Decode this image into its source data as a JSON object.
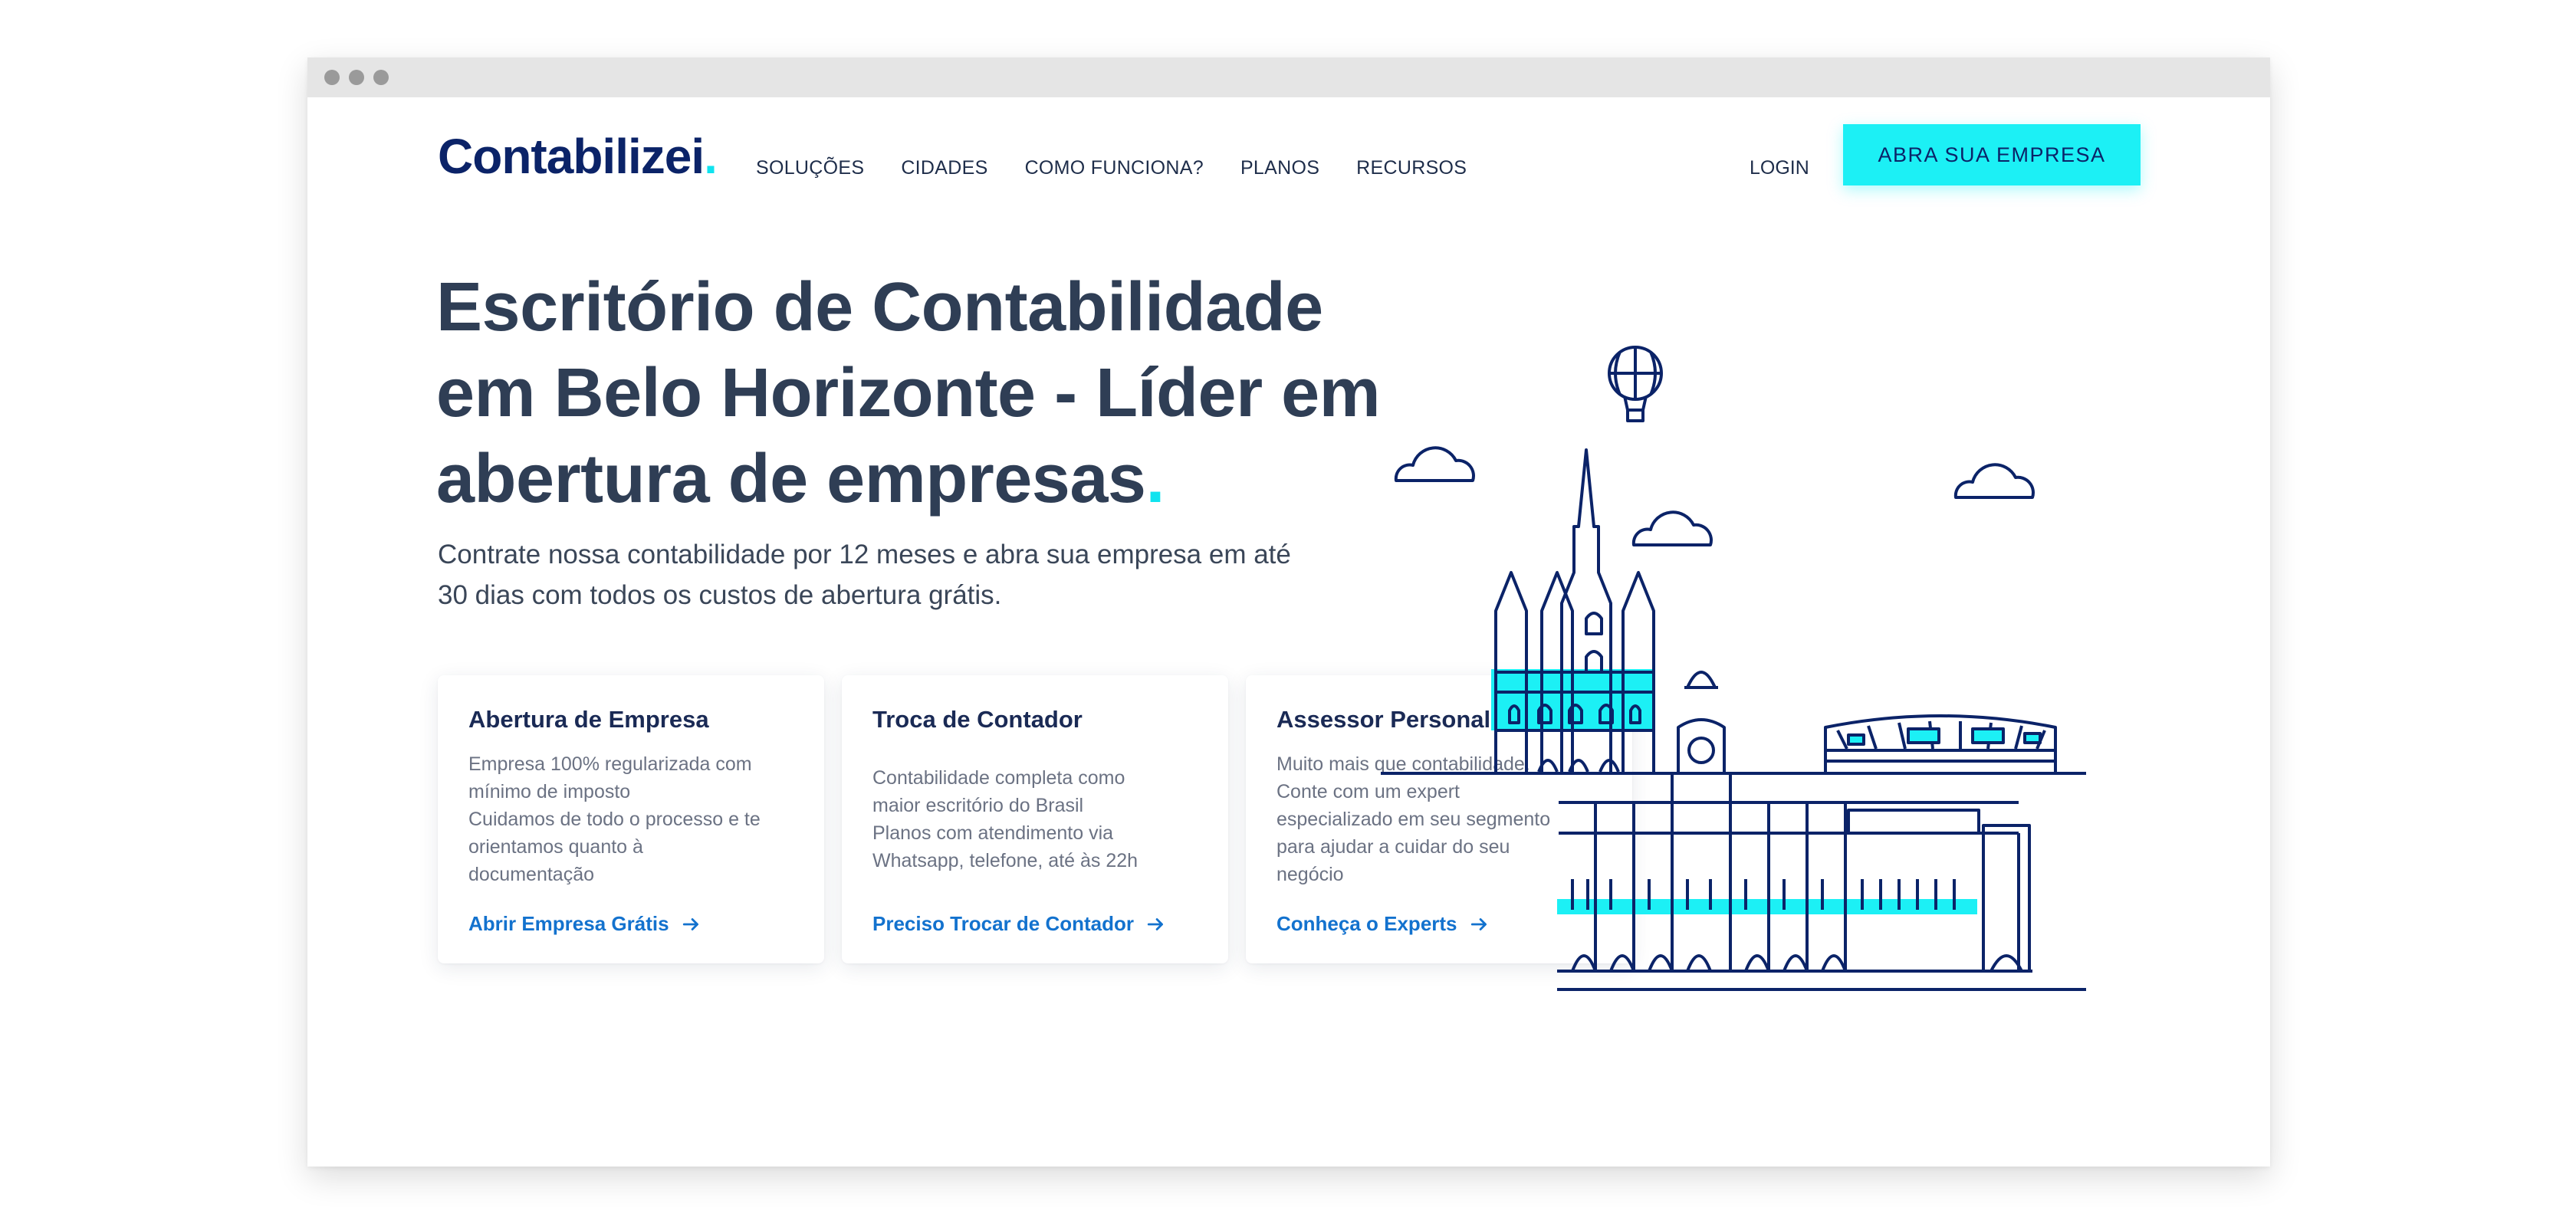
{
  "brand": {
    "name": "Contabilizei",
    "dot": "."
  },
  "nav": {
    "items": [
      "SOLUÇÕES",
      "CIDADES",
      "COMO FUNCIONA?",
      "PLANOS",
      "RECURSOS"
    ],
    "login": "LOGIN",
    "cta": "ABRA SUA EMPRESA"
  },
  "hero": {
    "title": "Escritório de Contabilidade em Belo Horizonte - Líder em abertura de empresas",
    "title_dot": ".",
    "subtitle": "Contrate nossa contabilidade por 12 meses e abra sua empresa em até 30 dias com todos os custos de abertura grátis."
  },
  "cards": [
    {
      "title": "Abertura de Empresa",
      "lines": [
        "Empresa 100% regularizada com",
        "mínimo de imposto",
        "Cuidamos de todo o processo e te",
        "orientamos quanto à",
        "documentação"
      ],
      "link": "Abrir Empresa Grátis"
    },
    {
      "title": "Troca de Contador",
      "lines": [
        "Contabilidade completa como",
        "maior escritório do Brasil",
        "Planos com atendimento via",
        "Whatsapp, telefone, até às 22h"
      ],
      "link": "Preciso Trocar de Contador"
    },
    {
      "title": "Assessor Personalizado",
      "lines": [
        "Muito mais que contabilidade.",
        "Conte com um expert",
        "especializado em seu segmento",
        "para ajudar a cuidar do seu",
        "negócio"
      ],
      "link": "Conheça o Experts"
    }
  ],
  "icons": {
    "card_link": "arrow-right-icon",
    "window_controls": "window-dot-icon"
  },
  "colors": {
    "brand_navy": "#0b2368",
    "accent_cyan": "#1cf0f5",
    "text_dark": "#2f3e55",
    "link_blue": "#1372ce"
  }
}
